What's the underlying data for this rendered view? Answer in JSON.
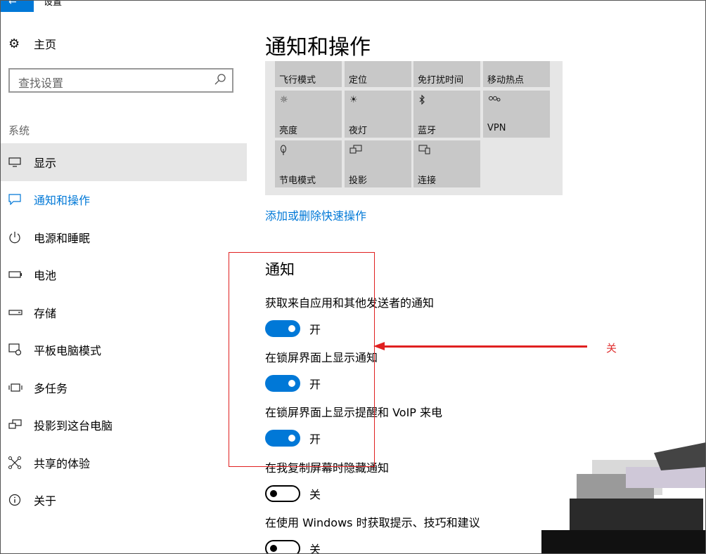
{
  "window": {
    "title": "设置"
  },
  "sidebar": {
    "home_label": "主页",
    "search_placeholder": "查找设置",
    "section_label": "系统",
    "items": [
      {
        "label": "显示",
        "icon": "monitor-icon"
      },
      {
        "label": "通知和操作",
        "icon": "message-icon"
      },
      {
        "label": "电源和睡眠",
        "icon": "power-icon"
      },
      {
        "label": "电池",
        "icon": "battery-icon"
      },
      {
        "label": "存储",
        "icon": "storage-icon"
      },
      {
        "label": "平板电脑模式",
        "icon": "tablet-mode-icon"
      },
      {
        "label": "多任务",
        "icon": "multitask-icon"
      },
      {
        "label": "投影到这台电脑",
        "icon": "project-icon"
      },
      {
        "label": "共享的体验",
        "icon": "shared-experience-icon"
      },
      {
        "label": "关于",
        "icon": "info-icon"
      }
    ]
  },
  "main": {
    "title": "通知和操作",
    "quick_actions": [
      {
        "label": "飞行模式"
      },
      {
        "label": "定位"
      },
      {
        "label": "免打扰时间"
      },
      {
        "label": "移动热点"
      },
      {
        "label": "亮度",
        "icon": "brightness-icon"
      },
      {
        "label": "夜灯",
        "icon": "night-light-icon"
      },
      {
        "label": "蓝牙",
        "icon": "bluetooth-icon"
      },
      {
        "label": "VPN",
        "icon": "vpn-icon"
      },
      {
        "label": "节电模式",
        "icon": "battery-saver-icon"
      },
      {
        "label": "投影",
        "icon": "project-icon"
      },
      {
        "label": "连接",
        "icon": "connect-icon"
      }
    ],
    "add_remove_link": "添加或删除快速操作",
    "notifications_title": "通知",
    "settings": [
      {
        "label": "获取来自应用和其他发送者的通知",
        "state": "开",
        "on": true
      },
      {
        "label": "在锁屏界面上显示通知",
        "state": "开",
        "on": true
      },
      {
        "label": "在锁屏界面上显示提醒和 VoIP 来电",
        "state": "开",
        "on": true
      },
      {
        "label": "在我复制屏幕时隐藏通知",
        "state": "关",
        "on": false
      },
      {
        "label": "在使用 Windows 时获取提示、技巧和建议",
        "state": "关",
        "on": false
      }
    ]
  },
  "annotation": {
    "text": "关",
    "color": "#e02020"
  },
  "colors": {
    "accent": "#0078d7",
    "tile": "#c8c8c8",
    "panel": "#e6e6e6"
  }
}
